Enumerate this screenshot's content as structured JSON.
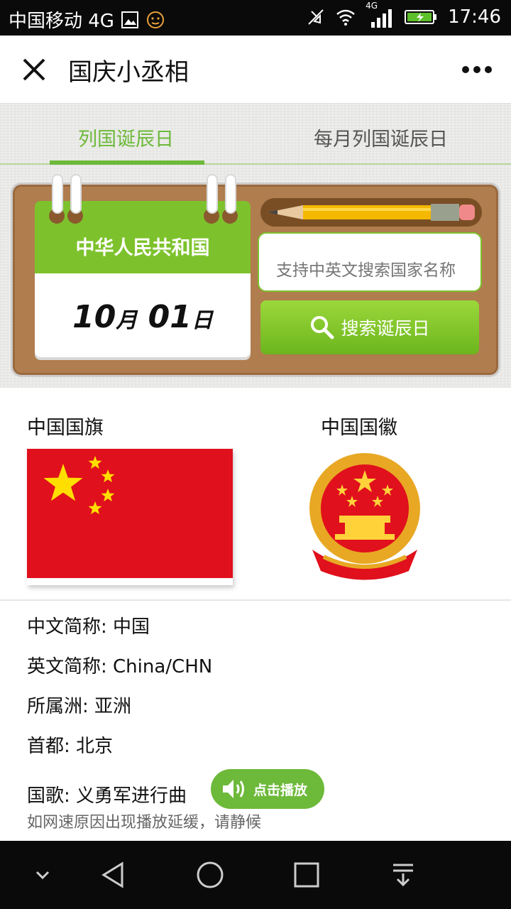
{
  "status_bar": {
    "carrier": "中国移动 4G",
    "network_small": "4G",
    "time": "17:46"
  },
  "titlebar": {
    "title": "国庆小丞相"
  },
  "tabs": [
    {
      "label": "列国诞辰日",
      "active": true
    },
    {
      "label": "每月列国诞辰日",
      "active": false
    }
  ],
  "calendar": {
    "country": "中华人民共和国",
    "month": "10",
    "month_unit": "月",
    "day": "01",
    "day_unit": "日"
  },
  "search": {
    "placeholder": "支持中英文搜索国家名称",
    "button_label": "搜索诞辰日"
  },
  "symbols": {
    "flag_label": "中国国旗",
    "emblem_label": "中国国徽"
  },
  "details": {
    "chinese_name": "中文简称: 中国",
    "english_name": "英文简称: China/CHN",
    "continent": "所属洲: 亚洲",
    "capital": "首都: 北京",
    "anthem": "国歌: 义勇军进行曲",
    "play_label": "点击播放",
    "note": "如网速原因出现播放延缓，请静候"
  },
  "colors": {
    "accent_green": "#6db93a",
    "board_brown": "#b07d4e",
    "flag_red": "#e0101c",
    "flag_yellow": "#ffde00"
  }
}
